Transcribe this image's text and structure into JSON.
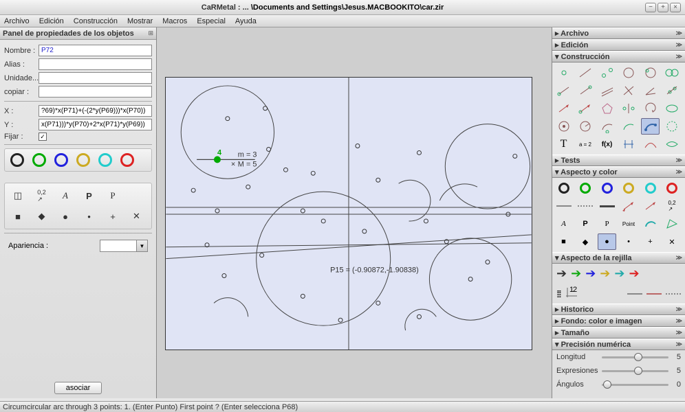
{
  "window": {
    "title_prefix": "CaRMetal : ... ",
    "title_path": "\\Documents and Settings\\Jesus.MACBOOKITO\\car.zir"
  },
  "menus": [
    "Archivo",
    "Edición",
    "Construcción",
    "Mostrar",
    "Macros",
    "Especial",
    "Ayuda"
  ],
  "left": {
    "header": "Panel de propiedades de los objetos",
    "name_lbl": "Nombre :",
    "name_val": "P72",
    "alias_lbl": "Alias :",
    "alias_val": "",
    "unit_lbl": "Unidade...",
    "unit_val": "",
    "copy_lbl": "copiar :",
    "copy_val": "",
    "x_lbl": "X :",
    "x_val": "?69)*x(P71)+(-(2*y(P69)))*x(P70))",
    "y_lbl": "Y :",
    "y_val": "x(P71)))*y(P70)+2*x(P71)*y(P69))",
    "fix_lbl": "Fijar :",
    "fix_checked": "✓",
    "appearance_lbl": "Apariencia :",
    "assoc": "asociar"
  },
  "canvas": {
    "m_label": "m = 3",
    "mm_label": "M = 5",
    "pt4": "4",
    "p15": "P15 = (-0.90872,-1.90838)"
  },
  "right": {
    "s_archivo": "Archivo",
    "s_edicion": "Edición",
    "s_construccion": "Construcción",
    "s_tests": "Tests",
    "s_aspecto": "Aspecto y color",
    "s_rejilla": "Aspecto de la rejilla",
    "s_historico": "Historico",
    "s_fondo": "Fondo: color e imagen",
    "s_tamano": "Tamaño",
    "s_precision": "Precisión numérica",
    "text_tool": "T",
    "eq_tool": "a = 2",
    "fx_tool": "f(x)",
    "a_lbl": "A",
    "p_lbl": "P",
    "pp_lbl": "P",
    "point_lbl": "Point",
    "slider_long": "Longitud",
    "slider_long_v": "5",
    "slider_expr": "Expresiones",
    "slider_expr_v": "5",
    "slider_ang": "Ángulos",
    "slider_ang_v": "0"
  },
  "status": "Circumcircular arc through 3 points: 1. (Enter Punto) First point ?  (Enter selecciona P68)",
  "colors": {
    "black": "#222",
    "green": "#0a0",
    "blue": "#22d",
    "yellow": "#ca2",
    "cyan": "#2cc",
    "red": "#d22"
  },
  "arrows": {
    "black": "#333",
    "green": "#1a1",
    "blue": "#22d",
    "yellow": "#ca2",
    "cyan": "#2aa",
    "red": "#d22"
  }
}
